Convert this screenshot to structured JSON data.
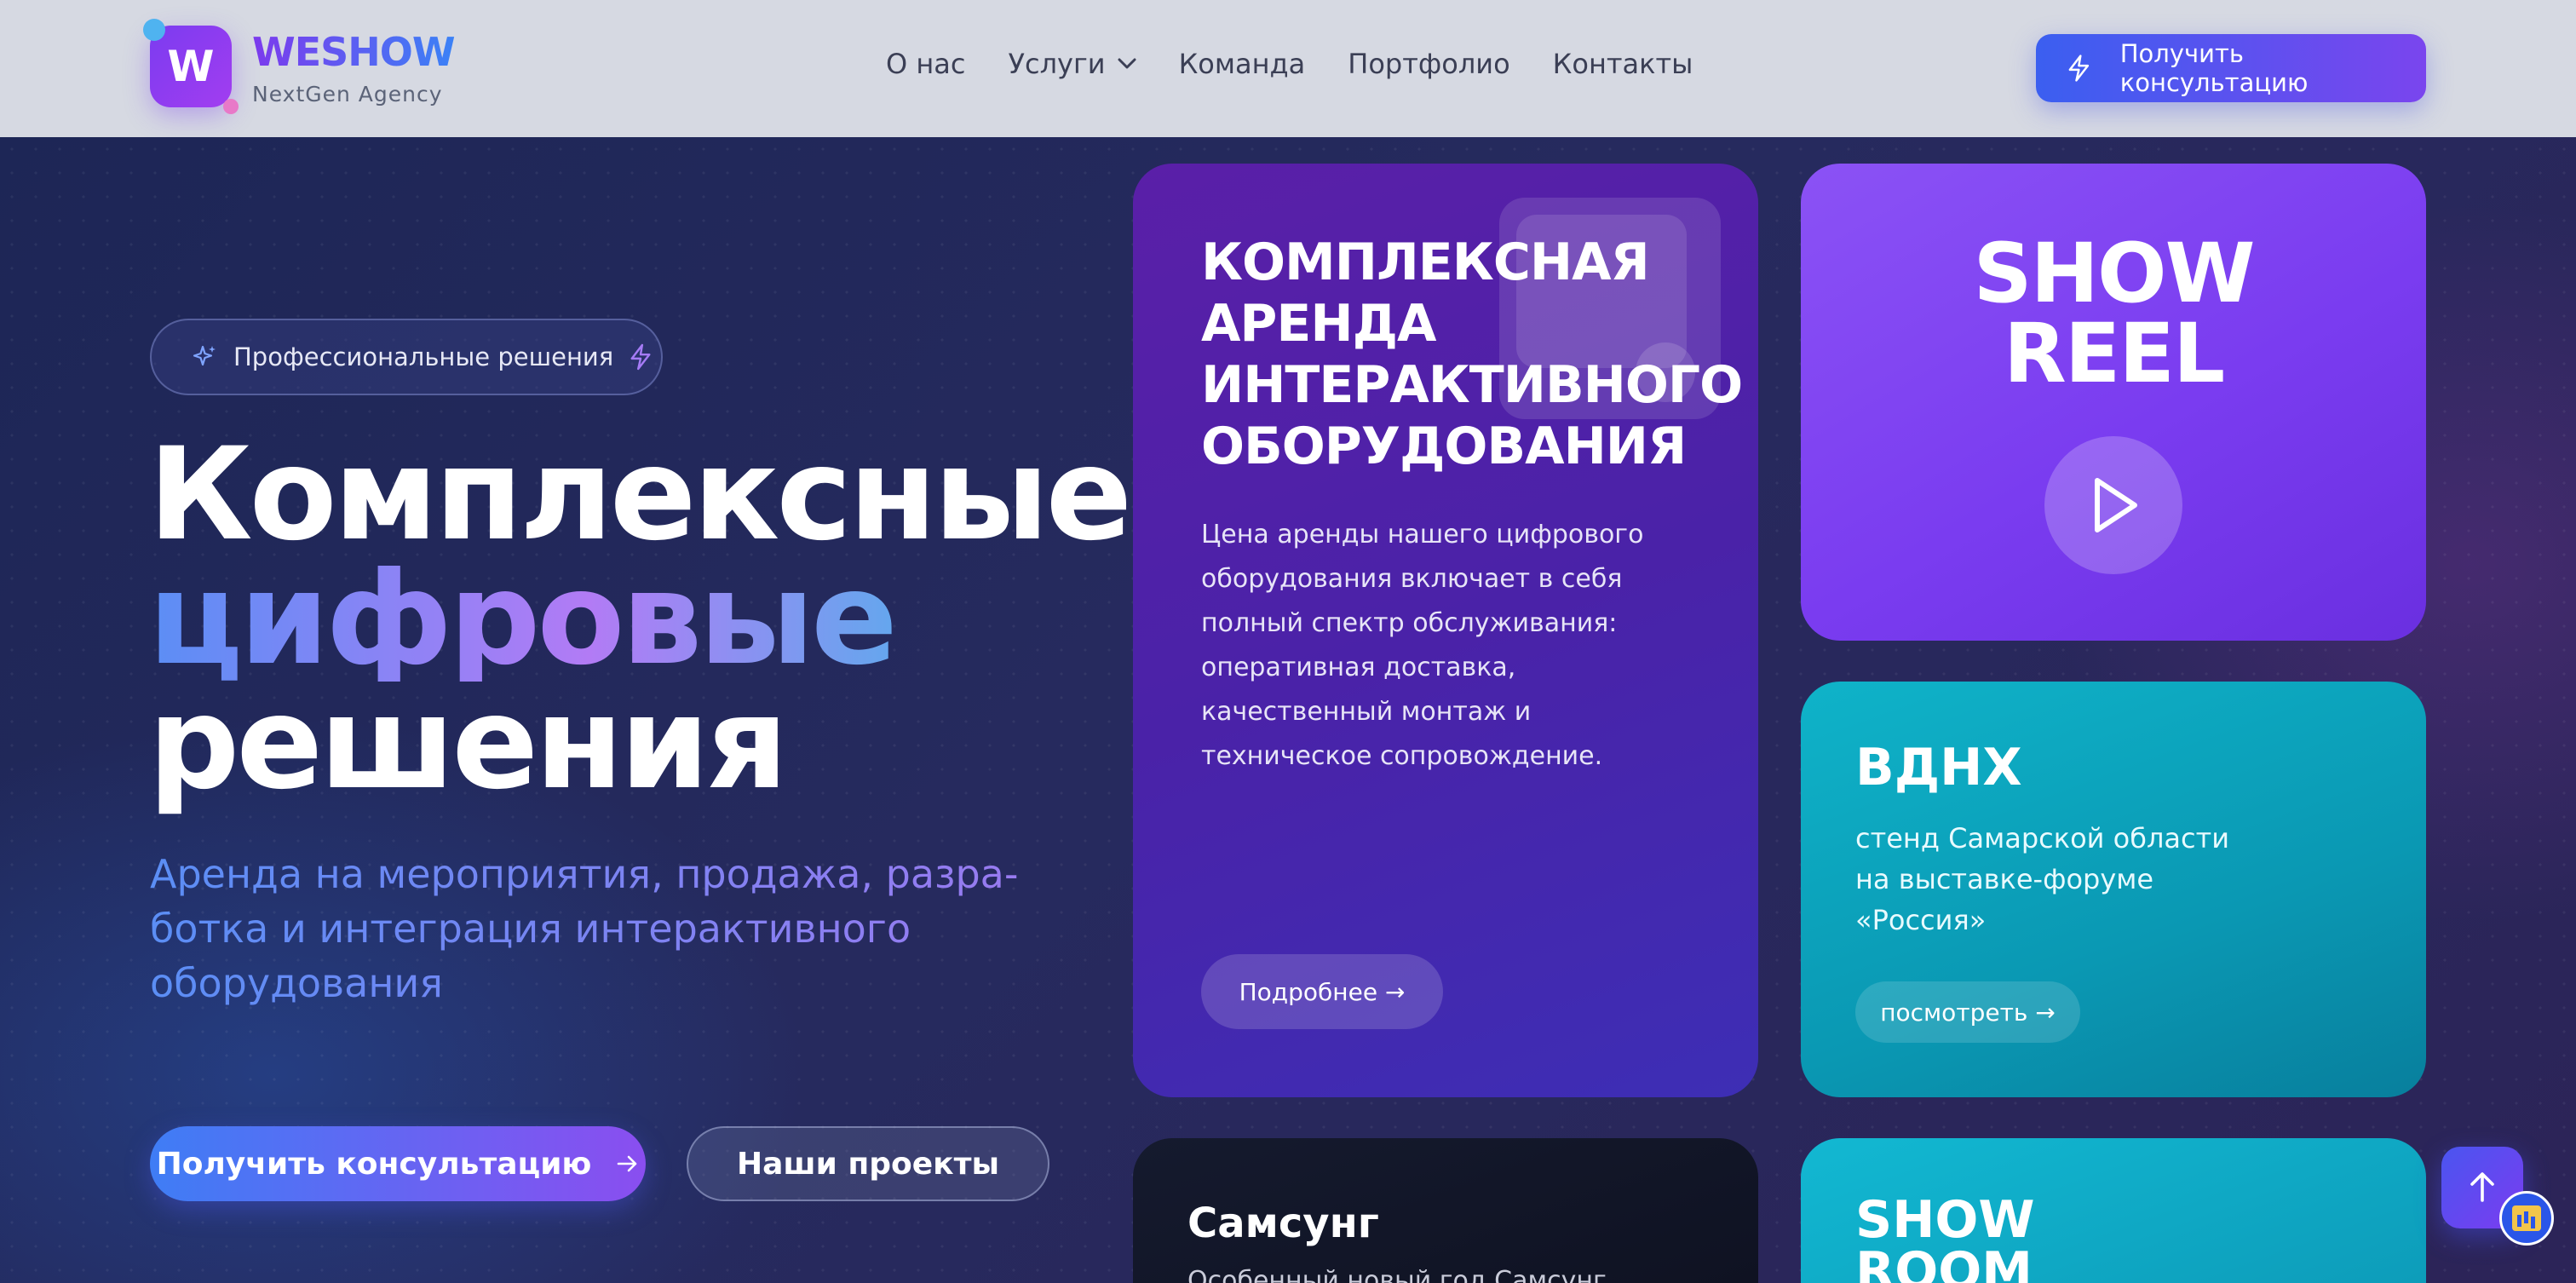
{
  "header": {
    "logo_letter": "W",
    "brand": "WESHOW",
    "tagline": "NextGen Agency",
    "nav": [
      {
        "label": "О нас"
      },
      {
        "label": "Услуги"
      },
      {
        "label": "Команда"
      },
      {
        "label": "Портфолио"
      },
      {
        "label": "Контакты"
      }
    ],
    "cta_label": "Получить консультацию"
  },
  "hero": {
    "badge_label": "Профессиональные решения",
    "title_line1": "Комплексные",
    "title_line2": "цифровые",
    "title_line3": "решения",
    "subtitle_line1": "Аренда на мероприятия, продажа, разра-",
    "subtitle_line2": "ботка и интеграция интерактивного",
    "subtitle_line3": "оборудования",
    "primary_button": "Получить консультацию",
    "secondary_button": "Наши проекты"
  },
  "cards": {
    "rent": {
      "title_line1": "КОМПЛЕКСНАЯ",
      "title_line2": "АРЕНДА",
      "title_line3": "ИНТЕРАКТИВНОГО",
      "title_line4": "ОБОРУДОВАНИЯ",
      "text_line1": "Цена аренды нашего цифрового",
      "text_line2": "оборудования включает в себя",
      "text_line3": "полный спектр обслуживания:",
      "text_line4": "оперативная доставка,",
      "text_line5": "качественный монтаж и",
      "text_line6": "техническое сопровождение.",
      "button": "Подробнее →"
    },
    "reel": {
      "title_line1": "SHOW",
      "title_line2": "REEL"
    },
    "vdnh": {
      "title": "ВДНХ",
      "text_line1": "стенд Самарской области",
      "text_line2": "на выставке-форуме",
      "text_line3": "«Россия»",
      "button": "посмотреть →"
    },
    "samsung": {
      "title": "Самсунг",
      "text": "Особенный новый год Самсунг"
    },
    "showroom": {
      "title_line1": "SHOW",
      "title_line2": "ROOM"
    }
  },
  "colors": {
    "accent_blue": "#3b5ff0",
    "accent_purple": "#7a45ee",
    "teal": "#0fb3c9",
    "header_bg": "#d6d9e2"
  },
  "icons": {
    "cta": "lightning-icon",
    "badge_left": "sparkles-icon",
    "badge_right": "lightning-icon",
    "play": "play-icon",
    "scroll_top": "arrow-up-icon",
    "services_dropdown": "chevron-down-icon"
  }
}
